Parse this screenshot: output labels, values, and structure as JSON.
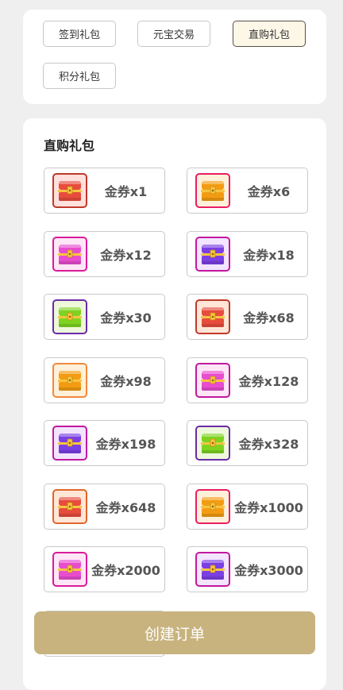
{
  "tabs": [
    {
      "label": "签到礼包",
      "active": false
    },
    {
      "label": "元宝交易",
      "active": false
    },
    {
      "label": "直购礼包",
      "active": true
    },
    {
      "label": "积分礼包",
      "active": false
    }
  ],
  "section": {
    "title": "直购礼包"
  },
  "items": [
    {
      "label": "金券x1",
      "icon": "red-treasure-chest-icon",
      "border": "#c0392b",
      "body": "#e74c3c",
      "bg": "#ffe0dc"
    },
    {
      "label": "金券x6",
      "icon": "orange-treasure-chest-icon",
      "border": "#e91e63",
      "body": "#f39c12",
      "bg": "#fff0d9"
    },
    {
      "label": "金券x12",
      "icon": "magenta-treasure-chest-icon",
      "border": "#d81b9a",
      "body": "#e84ccf",
      "bg": "#ffe6f6"
    },
    {
      "label": "金券x18",
      "icon": "purple-treasure-chest-icon",
      "border": "#c2189f",
      "body": "#7b3fe4",
      "bg": "#f3e4ff"
    },
    {
      "label": "金券x30",
      "icon": "green-treasure-chest-icon",
      "border": "#6a2ba8",
      "body": "#7ed321",
      "bg": "#eef9dc"
    },
    {
      "label": "金券x68",
      "icon": "red-treasure-chest-icon",
      "border": "#c0392b",
      "body": "#e74c3c",
      "bg": "#ffe6d6"
    },
    {
      "label": "金券x98",
      "icon": "orange-treasure-chest-icon",
      "border": "#f08a3c",
      "body": "#f39c12",
      "bg": "#fff0d9"
    },
    {
      "label": "金券x128",
      "icon": "magenta-treasure-chest-icon",
      "border": "#c2189f",
      "body": "#e84ccf",
      "bg": "#ffe6f6"
    },
    {
      "label": "金券x198",
      "icon": "purple-treasure-chest-icon",
      "border": "#c2189f",
      "body": "#7b3fe4",
      "bg": "#f3e4ff"
    },
    {
      "label": "金券x328",
      "icon": "green-treasure-chest-icon",
      "border": "#6a2ba8",
      "body": "#7ed321",
      "bg": "#eef9dc"
    },
    {
      "label": "金券x648",
      "icon": "red-treasure-chest-icon",
      "border": "#e0662b",
      "body": "#e74c3c",
      "bg": "#ffe6d6"
    },
    {
      "label": "金券x1000",
      "icon": "orange-treasure-chest-icon",
      "border": "#e91e63",
      "body": "#f39c12",
      "bg": "#fff0d9"
    },
    {
      "label": "金券x2000",
      "icon": "magenta-treasure-chest-icon",
      "border": "#d81b9a",
      "body": "#e84ccf",
      "bg": "#ffe6f6"
    },
    {
      "label": "金券x3000",
      "icon": "purple-treasure-chest-icon",
      "border": "#c2189f",
      "body": "#7b3fe4",
      "bg": "#f3e4ff"
    }
  ],
  "create_button": {
    "label": "创建订单"
  },
  "colors": {
    "accent": "#c8b37f",
    "active_tab_bg": "#fdf7e8",
    "page_bg": "#efefef"
  }
}
